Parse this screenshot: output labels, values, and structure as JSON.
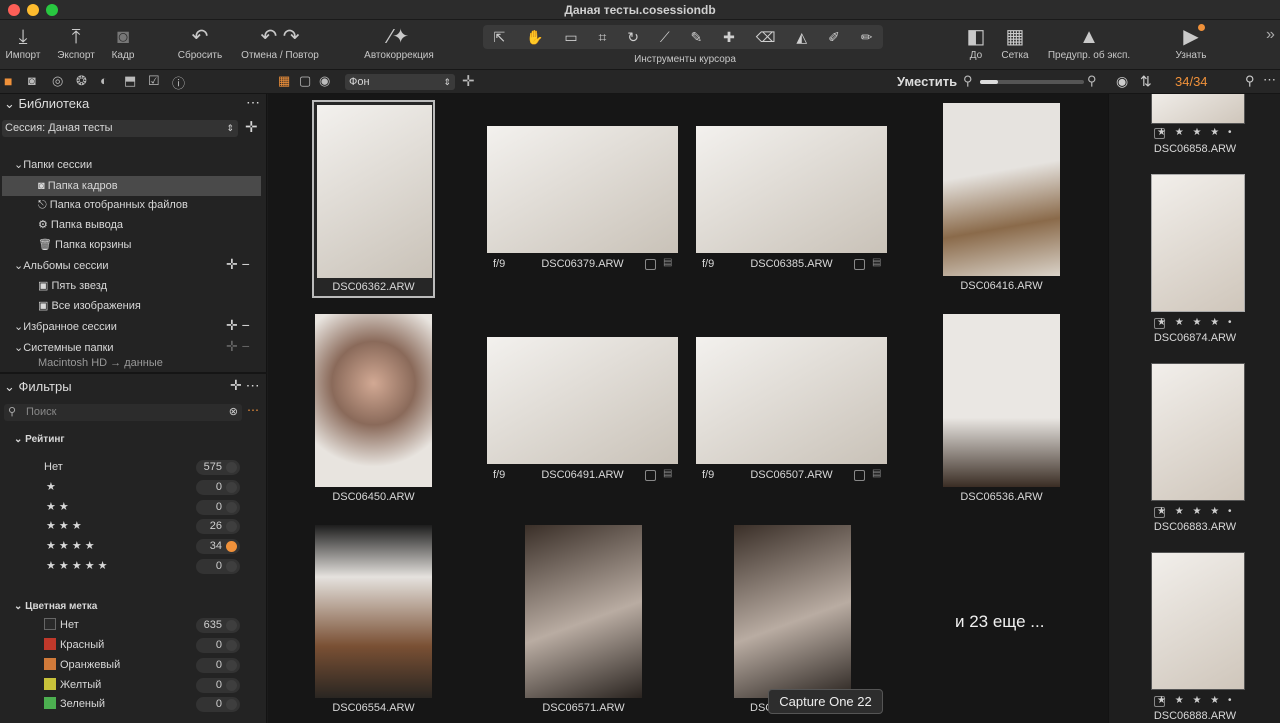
{
  "window": {
    "title": "Даная тесты.cosessiondb"
  },
  "toolbar": {
    "import": "Импорт",
    "export": "Экспорт",
    "frame": "Кадр",
    "reset": "Сбросить",
    "undo_redo": "Отмена / Повтор",
    "autocorrect": "Автокоррекция",
    "cursor_tools": "Инструменты курсора",
    "before": "До",
    "grid": "Сетка",
    "exposure_warning": "Предупр. об эксп.",
    "learn": "Узнать"
  },
  "subbar": {
    "background_select": "Фон",
    "fit": "Уместить",
    "count": "34/34"
  },
  "library": {
    "title": "Библиотека",
    "session": "Сессия: Даная тесты",
    "session_folders": "Папки сессии",
    "items": [
      "Папка кадров",
      "Папка отобранных файлов",
      "Папка вывода",
      "Папка корзины"
    ],
    "albums": "Альбомы сессии",
    "album_items": [
      "Пять звезд",
      "Все изображения"
    ],
    "favorites": "Избранное сессии",
    "system_folders": "Системные папки",
    "system_item": "Macintosh HD → данные"
  },
  "filters": {
    "title": "Фильтры",
    "search_placeholder": "Поиск",
    "rating_title": "Рейтинг",
    "ratings": [
      {
        "label": "Нет",
        "count": "575"
      },
      {
        "label": "★",
        "count": "0"
      },
      {
        "label": "★ ★",
        "count": "0"
      },
      {
        "label": "★ ★ ★",
        "count": "26"
      },
      {
        "label": "★ ★ ★ ★",
        "count": "34"
      },
      {
        "label": "★ ★ ★ ★ ★",
        "count": "0"
      }
    ],
    "color_title": "Цветная метка",
    "colors": [
      {
        "label": "Нет",
        "count": "635",
        "color": "#2a2a2a"
      },
      {
        "label": "Красный",
        "count": "0",
        "color": "#c0392b"
      },
      {
        "label": "Оранжевый",
        "count": "0",
        "color": "#d07a3a"
      },
      {
        "label": "Желтый",
        "count": "0",
        "color": "#c7c23a"
      },
      {
        "label": "Зеленый",
        "count": "0",
        "color": "#4caf50"
      }
    ]
  },
  "grid": {
    "images": [
      {
        "name": "DSC06362.ARW"
      },
      {
        "name": "DSC06379.ARW",
        "aperture": "f/9"
      },
      {
        "name": "DSC06385.ARW",
        "aperture": "f/9"
      },
      {
        "name": "DSC06416.ARW"
      },
      {
        "name": "DSC06450.ARW"
      },
      {
        "name": "DSC06491.ARW",
        "aperture": "f/9"
      },
      {
        "name": "DSC06507.ARW",
        "aperture": "f/9"
      },
      {
        "name": "DSC06536.ARW"
      },
      {
        "name": "DSC06554.ARW"
      },
      {
        "name": "DSC06571.ARW"
      },
      {
        "name": "DSC"
      }
    ],
    "more": "и 23 еще ...",
    "tooltip": "Capture One 22"
  },
  "right_panel": {
    "stars": "★ ★ ★ ★ •",
    "thumbs": [
      "DSC06858.ARW",
      "DSC06874.ARW",
      "DSC06883.ARW",
      "DSC06888.ARW"
    ]
  },
  "colors": {
    "accent": "#f0913a"
  }
}
